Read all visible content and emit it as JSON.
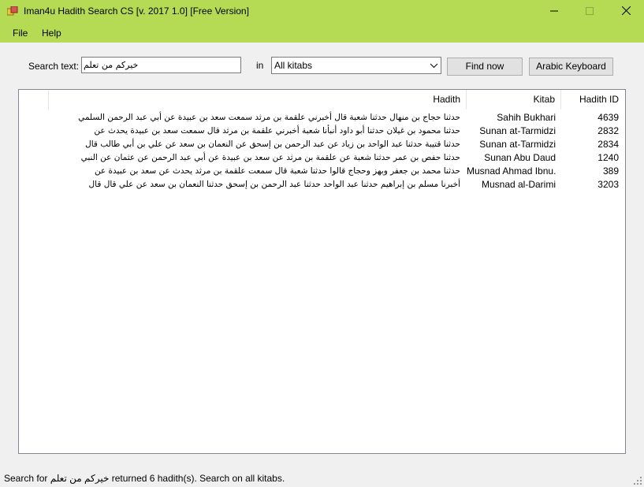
{
  "window": {
    "title": "Iman4u Hadith Search CS [v. 2017 1.0] [Free Version]",
    "titlebar_color": "#b5db55"
  },
  "menu": {
    "file": "File",
    "help": "Help"
  },
  "search": {
    "label": "Search text:",
    "value": "خيركم من تعلم",
    "in_label": "in",
    "kitab_selected": "All kitabs",
    "find_button": "Find now",
    "keyboard_button": "Arabic Keyboard"
  },
  "grid": {
    "columns": {
      "hadith": "Hadith",
      "kitab": "Kitab",
      "id": "Hadith ID"
    },
    "rows": [
      {
        "hadith": "حدثنا حجاج بن منهال حدثنا شعبة قال أخبرني علقمة بن مرثد سمعت سعد بن عبيدة عن أبي عبد الرحمن السلمي",
        "kitab": "Sahih Bukhari",
        "id": "4639"
      },
      {
        "hadith": "حدثنا محمود بن غيلان حدثنا أبو داود أنبأنا شعبة أخبرني علقمة بن مرثد قال سمعت سعد بن عبيدة يحدث عن",
        "kitab": "Sunan at-Tarmidzi",
        "id": "2832"
      },
      {
        "hadith": "حدثنا قتيبة حدثنا عبد الواحد بن زياد عن عبد الرحمن بن إسحق عن النعمان بن سعد عن علي بن أبي طالب قال",
        "kitab": "Sunan at-Tarmidzi",
        "id": "2834"
      },
      {
        "hadith": "حدثنا حفص بن عمر حدثنا شعبة عن علقمة بن مرثد عن سعد بن عبيدة عن أبي عبد الرحمن عن عثمان عن النبي",
        "kitab": "Sunan Abu Daud",
        "id": "1240"
      },
      {
        "hadith": "حدثنا محمد بن جعفر وبهز وحجاج قالوا حدثنا شعبة قال سمعت علقمة بن مرثد يحدث عن سعد بن عبيدة عن",
        "kitab": "Musnad Ahmad Ibnu...",
        "id": "389"
      },
      {
        "hadith": "أخبرنا مسلم بن إبراهيم حدثنا عبد الواحد حدثنا عبد الرحمن بن إسحق حدثنا النعمان بن سعد عن علي قال قال",
        "kitab": "Musnad al-Darimi",
        "id": "3203"
      }
    ]
  },
  "status": {
    "text": "Search for خيركم من تعلم returned 6 hadith(s). Search on all kitabs."
  }
}
